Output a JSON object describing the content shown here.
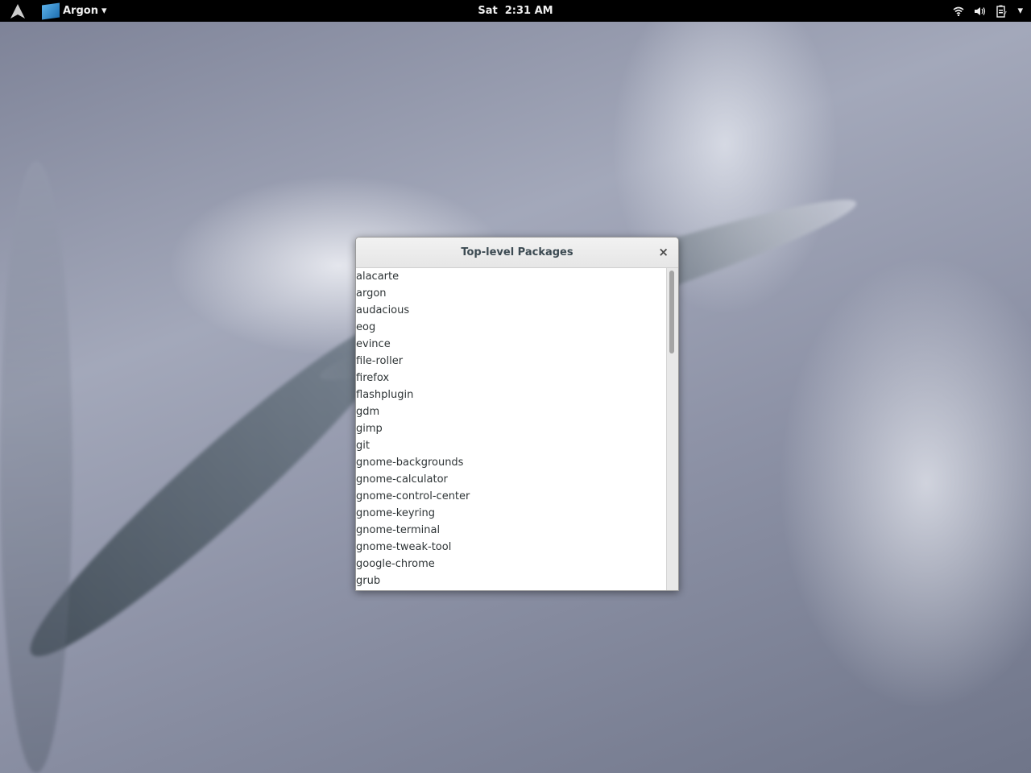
{
  "topbar": {
    "activities_icon": "arch-logo-icon",
    "app_menu": {
      "icon": "app-box-icon",
      "label": "Argon",
      "arrow": "▾"
    },
    "clock": "Sat  2:31 AM",
    "tray": {
      "wifi": "wifi-icon",
      "volume": "volume-icon",
      "battery": "battery-charging-icon",
      "menu_arrow": "▾"
    }
  },
  "dialog": {
    "title": "Top-level Packages",
    "close_glyph": "×",
    "items": [
      "alacarte",
      "argon",
      "audacious",
      "eog",
      "evince",
      "file-roller",
      "firefox",
      "flashplugin",
      "gdm",
      "gimp",
      "git",
      "gnome-backgrounds",
      "gnome-calculator",
      "gnome-control-center",
      "gnome-keyring",
      "gnome-terminal",
      "gnome-tweak-tool",
      "google-chrome",
      "grub"
    ]
  }
}
